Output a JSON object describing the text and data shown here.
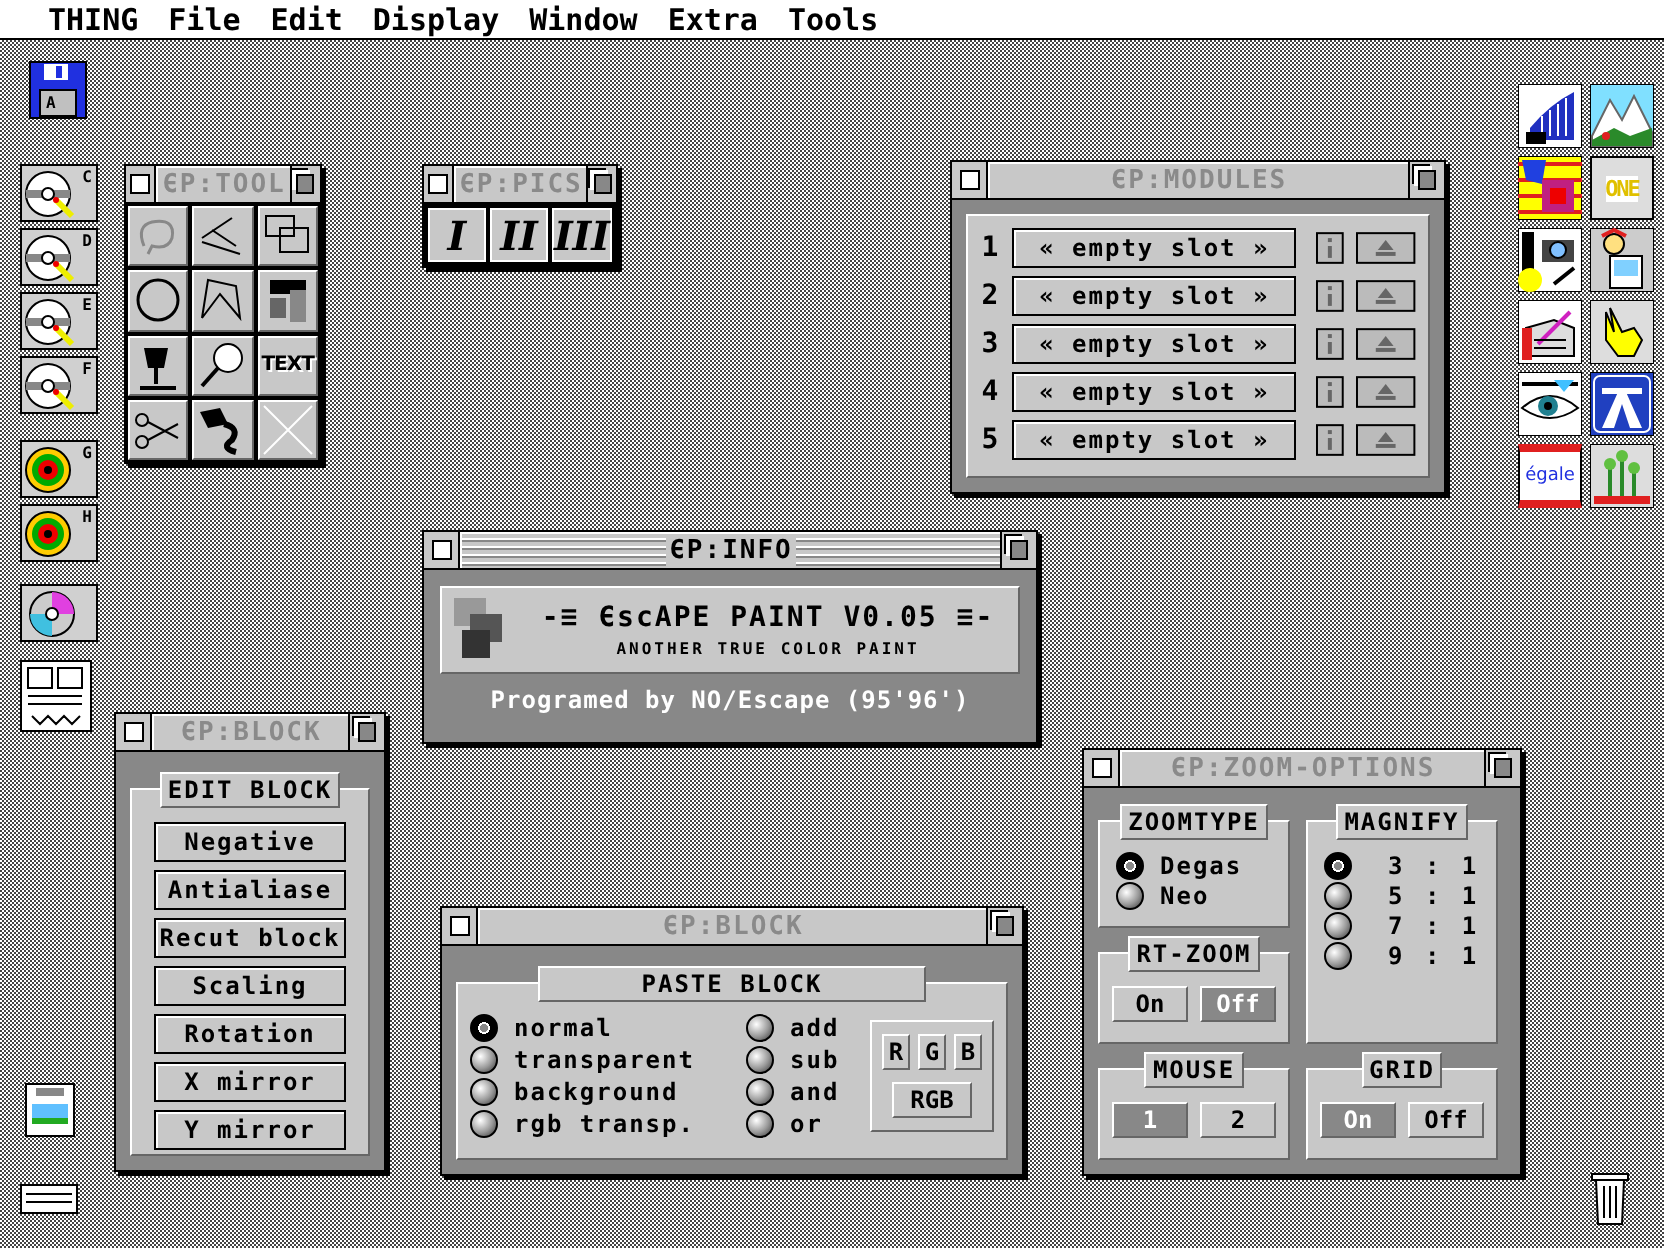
{
  "menu_bar": [
    "THING",
    "File",
    "Edit",
    "Display",
    "Window",
    "Extra",
    "Tools"
  ],
  "desktop_icons_left": [
    {
      "kind": "floppy",
      "label": "A"
    },
    {
      "kind": "hard-drive",
      "label": "C"
    },
    {
      "kind": "hard-drive",
      "label": "D"
    },
    {
      "kind": "hard-drive",
      "label": "E"
    },
    {
      "kind": "hard-drive",
      "label": "F"
    },
    {
      "kind": "cd",
      "label": "G"
    },
    {
      "kind": "cd",
      "label": "H"
    },
    {
      "kind": "disc"
    },
    {
      "kind": "document"
    },
    {
      "kind": "clipboard"
    },
    {
      "kind": "drive-slot"
    }
  ],
  "desktop_icons_right": [
    {
      "kind": "chart"
    },
    {
      "kind": "mountains"
    },
    {
      "kind": "squares"
    },
    {
      "kind": "letters",
      "label": "ONE"
    },
    {
      "kind": "camera"
    },
    {
      "kind": "computer"
    },
    {
      "kind": "notebook"
    },
    {
      "kind": "hand"
    },
    {
      "kind": "eye"
    },
    {
      "kind": "road-sign"
    },
    {
      "kind": "book",
      "label": "égale"
    },
    {
      "kind": "plant"
    }
  ],
  "windows": {
    "tool": {
      "title": "ЄP:TOOL",
      "active": false,
      "tools": [
        {
          "kind": "lasso"
        },
        {
          "kind": "lines"
        },
        {
          "kind": "rectangles"
        },
        {
          "kind": "circle"
        },
        {
          "kind": "polygon"
        },
        {
          "kind": "blocks"
        },
        {
          "kind": "paint"
        },
        {
          "kind": "magnifier"
        },
        {
          "kind": "text",
          "label": "TEXT"
        },
        {
          "kind": "scissors"
        },
        {
          "kind": "tube"
        },
        {
          "kind": "none"
        }
      ]
    },
    "pics": {
      "title": "ЄP:PICS",
      "active": false,
      "buttons": [
        "I",
        "II",
        "III"
      ]
    },
    "modules": {
      "title": "ЄP:MODULES",
      "active": false,
      "slots": [
        {
          "number": "1",
          "name": "« empty slot »"
        },
        {
          "number": "2",
          "name": "« empty slot »"
        },
        {
          "number": "3",
          "name": "« empty slot »"
        },
        {
          "number": "4",
          "name": "« empty slot »"
        },
        {
          "number": "5",
          "name": "« empty slot »"
        }
      ]
    },
    "info": {
      "title": "ЄP:INFO",
      "active": true,
      "logo_title": "-≡ ЄscAPE PAINT V0.05 ≡-",
      "subtitle": "ANOTHER TRUE COLOR PAINT",
      "credit": "Programed by NO/Escape (95'96')"
    },
    "edit_block": {
      "title": "ЄP:BLOCK",
      "active": false,
      "group": "EDIT BLOCK",
      "buttons": [
        "Negative",
        "Antialiase",
        "Recut block",
        "Scaling",
        "Rotation",
        "X mirror",
        "Y mirror"
      ]
    },
    "paste_block": {
      "title": "ЄP:BLOCK",
      "active": false,
      "group": "PASTE BLOCK",
      "modes": [
        {
          "label": "normal",
          "selected": true
        },
        {
          "label": "transparent",
          "selected": false
        },
        {
          "label": "background",
          "selected": false
        },
        {
          "label": "rgb transp.",
          "selected": false
        },
        {
          "label": "add",
          "selected": false
        },
        {
          "label": "sub",
          "selected": false
        },
        {
          "label": "and",
          "selected": false
        },
        {
          "label": "or",
          "selected": false
        }
      ],
      "channels": [
        "R",
        "G",
        "B"
      ],
      "rgb_button": "RGB"
    },
    "zoom_options": {
      "title": "ЄP:ZOOM-OPTIONS",
      "active": false,
      "zoomtype": {
        "title": "ZOOMTYPE",
        "options": [
          {
            "label": "Degas",
            "selected": true
          },
          {
            "label": "Neo",
            "selected": false
          }
        ]
      },
      "magnify": {
        "title": "MAGNIFY",
        "options": [
          {
            "label": "3 : 1",
            "selected": true
          },
          {
            "label": "5 : 1",
            "selected": false
          },
          {
            "label": "7 : 1",
            "selected": false
          },
          {
            "label": "9 : 1",
            "selected": false
          }
        ]
      },
      "rt_zoom": {
        "title": "RT-ZOOM",
        "options": [
          {
            "label": "On",
            "selected": false
          },
          {
            "label": "Off",
            "selected": true
          }
        ]
      },
      "mouse": {
        "title": "MOUSE",
        "options": [
          {
            "label": "1",
            "selected": true
          },
          {
            "label": "2",
            "selected": false
          }
        ]
      },
      "grid": {
        "title": "GRID",
        "options": [
          {
            "label": "On",
            "selected": true
          },
          {
            "label": "Off",
            "selected": false
          }
        ]
      }
    }
  }
}
